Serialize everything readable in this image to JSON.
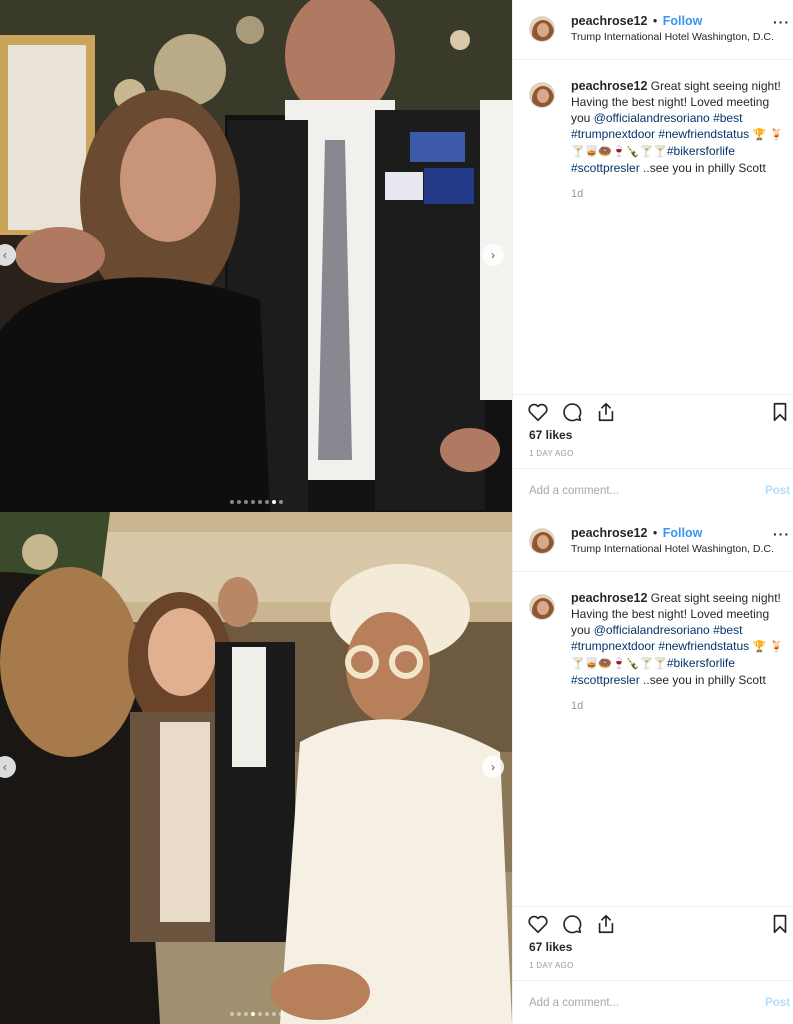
{
  "posts": [
    {
      "username": "peachrose12",
      "follow_label": "Follow",
      "location": "Trump International Hotel Washington, D.C.",
      "caption": {
        "username": "peachrose12",
        "text1": "Great sight seeing night! Having the best night! Loved meeting you",
        "mention": "@officialandresoriano",
        "tag_best": "#best",
        "tag_trump": "#trumpnextdoor",
        "tag_friend": "#newfriendstatus",
        "emoji1": "🏆",
        "emoji2": "🍹🍸🥃🍩🍷🍾🍸🍸",
        "tag_bikers": "#bikersforlife",
        "tag_scott": "#scottpresler",
        "text_end": "..see you in philly Scott"
      },
      "time_ago": "1d",
      "likes": "67 likes",
      "date": "1 DAY AGO",
      "comment_placeholder": "Add a comment...",
      "post_label": "Post",
      "carousel": {
        "count": 8,
        "active": 6
      }
    },
    {
      "username": "peachrose12",
      "follow_label": "Follow",
      "location": "Trump International Hotel Washington, D.C.",
      "caption": {
        "username": "peachrose12",
        "text1": "Great sight seeing night! Having the best night! Loved meeting you",
        "mention": "@officialandresoriano",
        "tag_best": "#best",
        "tag_trump": "#trumpnextdoor",
        "tag_friend": "#newfriendstatus",
        "emoji1": "🏆",
        "emoji2": "🍹🍸🥃🍩🍷🍾🍸🍸",
        "tag_bikers": "#bikersforlife",
        "tag_scott": "#scottpresler",
        "text_end": "..see you in philly Scott"
      },
      "time_ago": "1d",
      "likes": "67 likes",
      "date": "1 DAY AGO",
      "comment_placeholder": "Add a comment...",
      "post_label": "Post",
      "carousel": {
        "count": 8,
        "active": 3
      }
    }
  ],
  "icons": {
    "like": "heart-icon",
    "comment": "comment-icon",
    "share": "share-icon",
    "save": "bookmark-icon",
    "more": "more-icon"
  },
  "colors": {
    "follow": "#3897f0",
    "hashtag": "#003569",
    "muted": "#999999",
    "post_disabled": "#b2dffc"
  }
}
